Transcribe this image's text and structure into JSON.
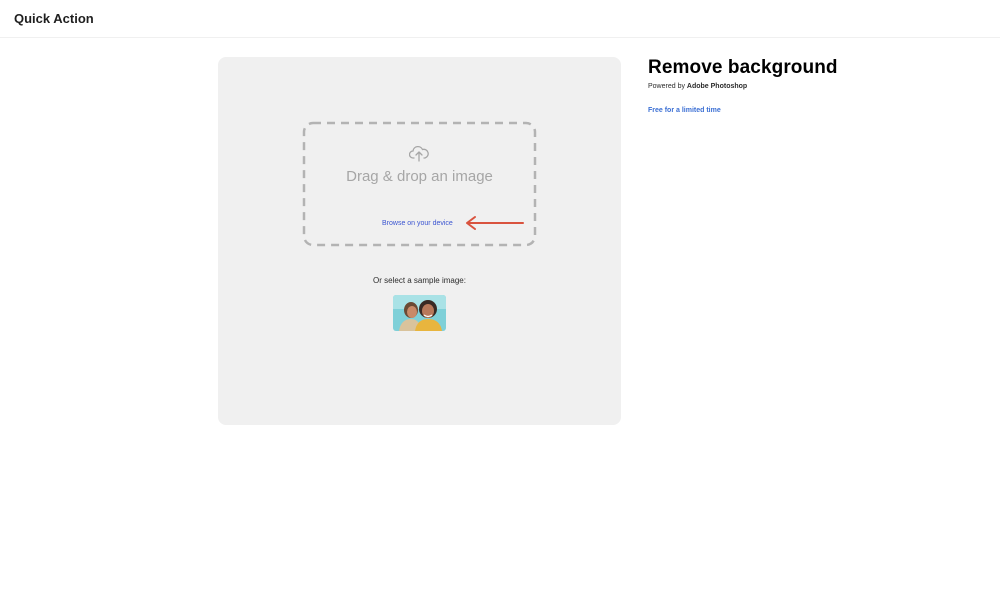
{
  "header": {
    "title": "Quick Action"
  },
  "dropzone": {
    "icon": "upload-cloud-icon",
    "label": "Drag & drop an image",
    "browse_label": "Browse on your device",
    "annotation_color": "#d9533e"
  },
  "samples": {
    "label": "Or select a sample image:"
  },
  "side": {
    "title": "Remove background",
    "powered_prefix": "Powered by",
    "powered_brand": "Adobe Photoshop",
    "promo": "Free for a limited time"
  },
  "colors": {
    "panel_bg": "#f0f0f0",
    "link": "#3b55d1",
    "promo": "#3b6fd4"
  }
}
